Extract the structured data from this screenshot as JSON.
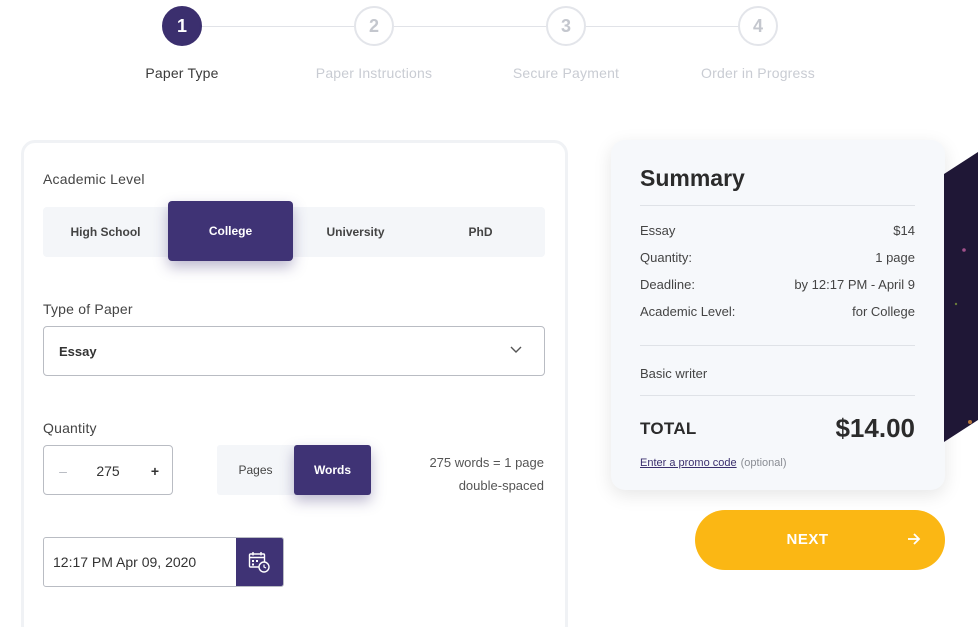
{
  "stepper": {
    "steps": [
      {
        "number": "1",
        "label": "Paper Type",
        "active": true
      },
      {
        "number": "2",
        "label": "Paper Instructions",
        "active": false
      },
      {
        "number": "3",
        "label": "Secure Payment",
        "active": false
      },
      {
        "number": "4",
        "label": "Order in Progress",
        "active": false
      }
    ]
  },
  "form": {
    "academic_level": {
      "label": "Academic Level",
      "options": [
        "High School",
        "College",
        "University",
        "PhD"
      ],
      "selected": "College"
    },
    "paper_type": {
      "label": "Type of Paper",
      "value": "Essay"
    },
    "quantity": {
      "label": "Quantity",
      "minus": "–",
      "value": "275",
      "plus": "+",
      "units": [
        "Pages",
        "Words"
      ],
      "selected_unit": "Words",
      "note_line1": "275 words = 1 page",
      "note_line2": "double-spaced"
    },
    "deadline": {
      "value": "12:17 PM Apr 09, 2020"
    }
  },
  "summary": {
    "title": "Summary",
    "rows": [
      {
        "key": "Essay",
        "value": "$14"
      },
      {
        "key": "Quantity:",
        "value": "1 page"
      },
      {
        "key": "Deadline:",
        "value": "by 12:17 PM - April 9"
      },
      {
        "key": "Academic Level:",
        "value": "for College"
      }
    ],
    "writer": "Basic writer",
    "total_label": "TOTAL",
    "total_value": "$14.00",
    "promo_link": "Enter a promo code",
    "promo_optional": "(optional)"
  },
  "next_button": {
    "label": "NEXT"
  },
  "colors": {
    "primary": "#3f3375",
    "accent": "#fbb714",
    "panel": "#f6f8fb"
  },
  "icons": [
    "calendar-clock-icon",
    "chevron-down-icon",
    "arrow-right-icon"
  ]
}
